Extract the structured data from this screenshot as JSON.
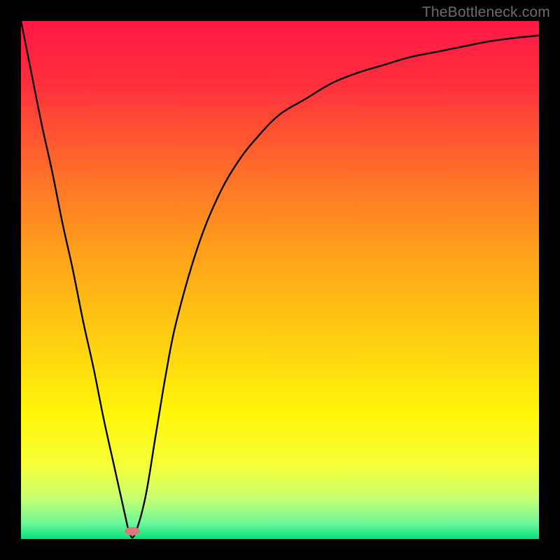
{
  "watermark": "TheBottleneck.com",
  "chart_data": {
    "type": "line",
    "title": "",
    "xlabel": "",
    "ylabel": "",
    "xlim": [
      0,
      100
    ],
    "ylim": [
      0,
      100
    ],
    "grid": false,
    "legend": false,
    "gradient_stops": [
      {
        "pos": 0.0,
        "color": "#ff1846"
      },
      {
        "pos": 0.12,
        "color": "#ff2f3d"
      },
      {
        "pos": 0.28,
        "color": "#ff6a2a"
      },
      {
        "pos": 0.45,
        "color": "#ffa21a"
      },
      {
        "pos": 0.62,
        "color": "#ffd010"
      },
      {
        "pos": 0.76,
        "color": "#fff60a"
      },
      {
        "pos": 0.86,
        "color": "#f4ff3a"
      },
      {
        "pos": 0.92,
        "color": "#c8ff70"
      },
      {
        "pos": 0.97,
        "color": "#6cf79a"
      },
      {
        "pos": 1.0,
        "color": "#05e27a"
      }
    ],
    "series": [
      {
        "name": "bottleneck-curve",
        "x": [
          0,
          2,
          4,
          6,
          8,
          10,
          12,
          14,
          16,
          18,
          20,
          21,
          22,
          24,
          26,
          28,
          30,
          34,
          38,
          42,
          46,
          50,
          55,
          60,
          65,
          70,
          75,
          80,
          85,
          90,
          95,
          100
        ],
        "y": [
          100,
          90,
          80,
          71,
          61,
          52,
          42,
          33,
          23,
          14,
          5,
          1,
          1,
          8,
          20,
          32,
          42,
          56,
          66,
          73,
          78,
          82,
          85,
          88,
          90,
          91.5,
          93,
          94,
          95,
          96,
          96.7,
          97.2
        ]
      }
    ],
    "marker": {
      "x_frac": 0.215,
      "y_frac": 0.985,
      "color": "#d97a7a",
      "rx": 11,
      "ry": 6
    }
  }
}
